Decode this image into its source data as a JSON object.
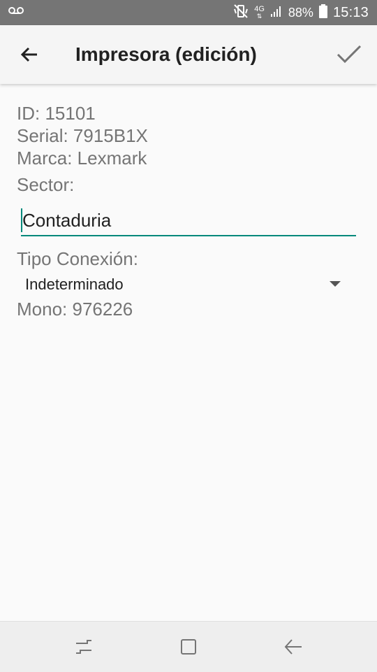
{
  "status_bar": {
    "icons": [
      "voicemail-icon",
      "mute-vibrate-icon",
      "network-4g-icon",
      "signal-icon",
      "battery-icon"
    ],
    "network_label": "4G",
    "battery": "88%",
    "time": "15:13"
  },
  "app_bar": {
    "title": "Impresora (edición)",
    "back_icon": "arrow-left-icon",
    "confirm_icon": "check-icon"
  },
  "details": {
    "id": "ID: 15101",
    "serial": "Serial: 7915B1X",
    "marca": "Marca: Lexmark",
    "sector_label": "Sector:"
  },
  "sector_input": {
    "value": "Contaduria"
  },
  "tipo_conexion": {
    "label": "Tipo Conexión:",
    "selected": "Indeterminado"
  },
  "mono": "Mono: 976226",
  "nav_bar": {
    "icons": [
      "recent-apps-icon",
      "home-icon",
      "back-icon"
    ]
  },
  "colors": {
    "accent": "#00897b",
    "status_bar": "#757575",
    "app_bar": "#f5f5f5"
  }
}
